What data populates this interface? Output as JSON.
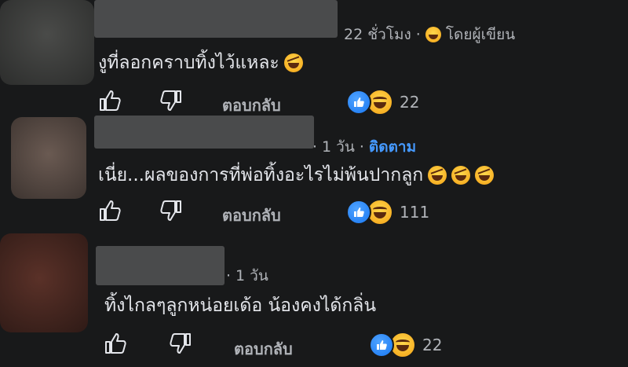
{
  "comments": [
    {
      "avatar_color": "#3a3b3a",
      "time": "22 ชั่วโมง",
      "author_label": "โดยผู้เขียน",
      "text": "งูที่ลอกคราบทิ้งไว้แหละ",
      "reply_label": "ตอบกลับ",
      "reaction_count": "22"
    },
    {
      "avatar_color": "#5a4a42",
      "time": "1 วัน",
      "follow_label": "ติดตาม",
      "text": "เนี่ย...ผลของการที่พ่อทิ้งอะไรไม่พ้นปากลูก",
      "reply_label": "ตอบกลับ",
      "reaction_count": "111"
    },
    {
      "avatar_color": "#4a2b25",
      "time": "1 วัน",
      "text": "ทิ้งไกลๆลูกหน่อยเด้อ น้องคงได้กลิ่น",
      "reply_label": "ตอบกลับ",
      "reaction_count": "22"
    }
  ],
  "separator": "·",
  "colors": {
    "background": "#18191a",
    "link": "#4599ff",
    "like": "#1877f2"
  },
  "icons": [
    "thumbs-up-icon",
    "thumbs-down-icon",
    "like-reaction-icon",
    "haha-reaction-icon",
    "rolling-laugh-emoji"
  ]
}
